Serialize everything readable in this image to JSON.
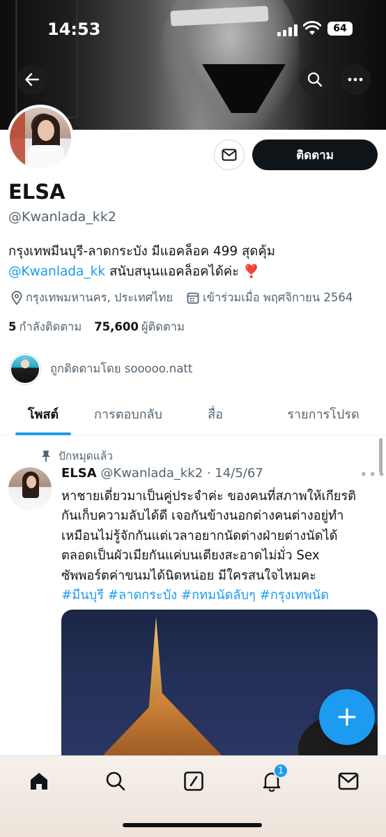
{
  "status_bar": {
    "time": "14:53",
    "battery": "64"
  },
  "profile": {
    "name": "ELSA",
    "handle": "@Kwanlada_kk2",
    "follow_label": "ติดตาม",
    "bio_line1": "กรุงเทพมีนบุรี-ลาดกระบัง มีแอคล็อค 499 สุดคุ้ม",
    "bio_link": "@Kwanlada_kk",
    "bio_line2_rest": " สนับสนุนแอคล็อคได้ค่ะ ",
    "bio_emoji": "❣️",
    "location": "กรุงเทพมหานคร, ประเทศไทย",
    "joined": "เข้าร่วมเมื่อ พฤศจิกายน 2564",
    "following_count": "5",
    "following_label": "กำลังติดตาม",
    "followers_count": "75,600",
    "followers_label": "ผู้ติดตาม",
    "followed_by": "ถูกติดตามโดย sooooo.natt"
  },
  "tabs": [
    "โพสต์",
    "การตอบกลับ",
    "สื่อ",
    "รายการโปรด"
  ],
  "tweet": {
    "pinned_label": "ปักหมุดแล้ว",
    "author_name": "ELSA",
    "author_handle": "@Kwanlada_kk2",
    "date": "· 14/5/67",
    "lines": [
      "หาชายเดี่ยวมาเป็นคู่ประจำค่ะ ของคนที่สภาพให้เกียรติ",
      "กันเก็บความลับได้ดี เจอกันข้างนอกต่างคนต่างอยู่ทำ",
      "เหมือนไม่รู้จักกันแต่เวลาอยากนัดต่างฝ่ายต่างนัดได้",
      "ตลอดเป็นผัวเมียกันแค่บนเตียงสะอาดไม่มั่ว Sex",
      "ซัพพอร์ตค่าขนมได้นิดหน่อย มีใครสนใจไหมคะ"
    ],
    "hashtags": "#มีนบุรี #ลาดกระบัง #กทมนัดลับๆ #กรุงเทพนัด"
  },
  "nav": {
    "notification_badge": "1"
  },
  "icons": [
    "back-arrow-icon",
    "search-icon",
    "more-icon",
    "mail-icon",
    "location-icon",
    "calendar-icon",
    "pin-icon",
    "plus-icon",
    "home-icon",
    "compose-icon",
    "bell-icon"
  ],
  "colors": {
    "accent": "#1d9bf0",
    "text": "#0f1419",
    "muted": "#536471"
  }
}
